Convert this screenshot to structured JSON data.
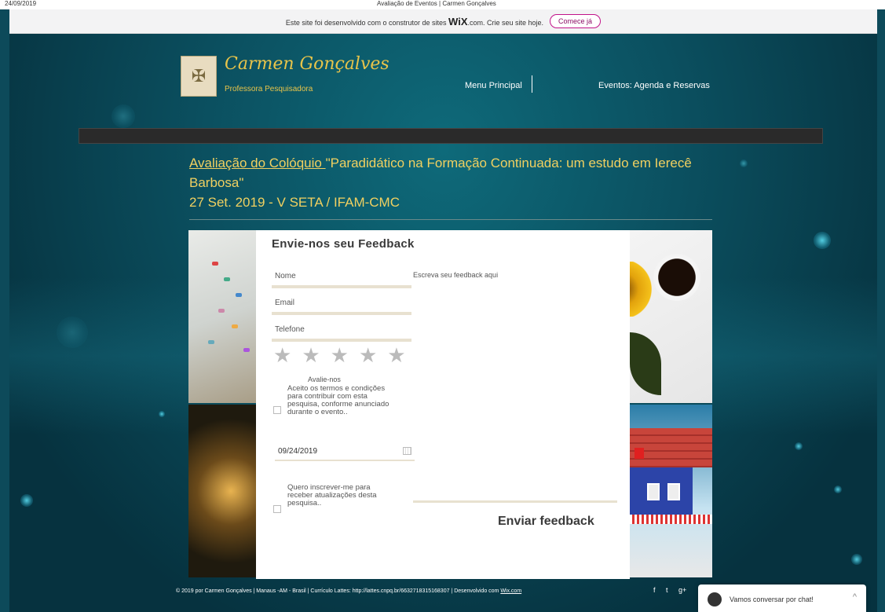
{
  "print_header": {
    "date": "24/09/2019",
    "title": "Avaliação de Eventos | Carmen Gonçalves"
  },
  "wix_banner": {
    "text_before": "Este site foi desenvolvido com o construtor de sites",
    "logo": "WiX",
    "text_after": ".com. Crie seu site hoje.",
    "button": "Comece já"
  },
  "site_header": {
    "brand_name": "Carmen Gonçalves",
    "brand_subtitle": "Professora Pesquisadora",
    "nav": {
      "main": "Menu Principal",
      "events": "Eventos: Agenda e Reservas"
    }
  },
  "page_heading": {
    "link_text": "Avaliação do Colóquio ",
    "title_rest": "\"Paradidático na Formação Continuada: um estudo em Ierecê Barbosa\"",
    "line2": "27 Set. 2019 - V SETA / IFAM-CMC"
  },
  "form": {
    "title": "Envie-nos seu Feedback",
    "name_placeholder": "Nome",
    "email_placeholder": "Email",
    "phone_placeholder": "Telefone",
    "rating_label": "Avalie-nos",
    "terms_label": "Aceito os termos e condições para contribuir com esta pesquisa, conforme anunciado durante o evento..",
    "date_value": "09/24/2019",
    "subscribe_label": "Quero inscrever-me para receber atualizações desta pesquisa..",
    "feedback_placeholder": "Escreva seu feedback aqui",
    "submit_label": "Enviar feedback",
    "rating_value": 0,
    "rating_max": 5
  },
  "footer": {
    "text": "© 2019 por Carmen Gonçalves | Manaus -AM - Brasil | Currículo Lattes: http://lattes.cnpq.br/6632718315168307 | Desenvolvido com ",
    "link": "Wix.com",
    "social": [
      "f",
      "t",
      "g+"
    ]
  },
  "chat": {
    "label": "Vamos conversar por chat!"
  },
  "colors": {
    "accent_gold": "#f0d060",
    "wix_button": "#c2138a",
    "background": "#0d4a5a"
  },
  "icons": [
    "calendar-icon",
    "star-icon",
    "facebook-icon",
    "twitter-icon",
    "google-plus-icon",
    "chat-avatar-icon",
    "chevron-up-icon"
  ]
}
